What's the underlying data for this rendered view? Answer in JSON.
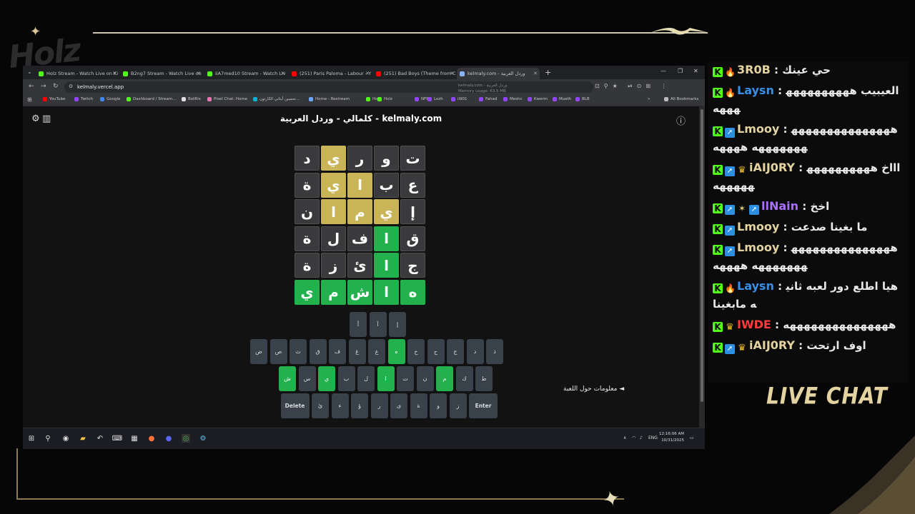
{
  "overlay": {
    "logo_text": "Holz",
    "live_chat_label": "LIVE CHAT"
  },
  "browser": {
    "tabs": [
      {
        "label": "Holz Stream - Watch Live on Ki",
        "color": "#53fc18"
      },
      {
        "label": "B2ng7 Stream - Watch Live on",
        "color": "#53fc18"
      },
      {
        "label": "iiA7med10 Stream - Watch Liv",
        "color": "#53fc18"
      },
      {
        "label": "(251) Paris Paloma - Labour - Y",
        "color": "#ff0000"
      },
      {
        "label": "(251) Bad Boys (Theme from Co",
        "color": "#ff0000"
      },
      {
        "label": "kelmaly.com - وردل العربية",
        "color": "#8ab4f8"
      }
    ],
    "url": "kelmaly.vercel.app",
    "suggestion_lines": [
      "kelmaly.com - وردل العربية",
      "Memory usage: 63.5 MB"
    ],
    "bookmarks": [
      {
        "label": "YouTube",
        "color": "#ff0000"
      },
      {
        "label": "Twitch",
        "color": "#9146ff"
      },
      {
        "label": "Google",
        "color": "#4285f4"
      },
      {
        "label": "Dashboard / Stream...",
        "color": "#53fc18"
      },
      {
        "label": "BotRix",
        "color": "#e0e0e0"
      },
      {
        "label": "Pixel Chat: Home",
        "color": "#f472b6"
      },
      {
        "label": "تحسين أبتاني الكارتون...",
        "color": "#00b4d8"
      },
      {
        "label": "Home - Restream",
        "color": "#6ea8fe"
      },
      {
        "label": "Holz",
        "color": "#53fc18"
      },
      {
        "label": "Holz",
        "color": "#53fc18"
      },
      {
        "label": "NFR",
        "color": "#9146ff"
      },
      {
        "label": "Lozh",
        "color": "#9146ff"
      },
      {
        "label": "ii901",
        "color": "#9146ff"
      },
      {
        "label": "Fahad",
        "color": "#9146ff"
      },
      {
        "label": "Meshc",
        "color": "#9146ff"
      },
      {
        "label": "Kwerm",
        "color": "#9146ff"
      },
      {
        "label": "Mueth",
        "color": "#9146ff"
      },
      {
        "label": "BLB",
        "color": "#9146ff"
      }
    ],
    "all_bookmarks": "All Bookmarks"
  },
  "page": {
    "title": "كلمالي - وردل العربية - kelmaly.com",
    "game_info": "معلومات حول اللعبة ◄"
  },
  "board": [
    [
      {
        "l": "ت",
        "s": "absent"
      },
      {
        "l": "و",
        "s": "absent"
      },
      {
        "l": "ر",
        "s": "absent"
      },
      {
        "l": "ي",
        "s": "present"
      },
      {
        "l": "د",
        "s": "absent"
      }
    ],
    [
      {
        "l": "ع",
        "s": "absent"
      },
      {
        "l": "ب",
        "s": "absent"
      },
      {
        "l": "ا",
        "s": "present"
      },
      {
        "l": "ي",
        "s": "present"
      },
      {
        "l": "ة",
        "s": "absent"
      }
    ],
    [
      {
        "l": "إ",
        "s": "absent"
      },
      {
        "l": "ي",
        "s": "present"
      },
      {
        "l": "م",
        "s": "present"
      },
      {
        "l": "ا",
        "s": "present"
      },
      {
        "l": "ن",
        "s": "absent"
      }
    ],
    [
      {
        "l": "ق",
        "s": "absent"
      },
      {
        "l": "ا",
        "s": "correct"
      },
      {
        "l": "ف",
        "s": "absent"
      },
      {
        "l": "ل",
        "s": "absent"
      },
      {
        "l": "ة",
        "s": "absent"
      }
    ],
    [
      {
        "l": "ج",
        "s": "absent"
      },
      {
        "l": "ا",
        "s": "correct"
      },
      {
        "l": "ئ",
        "s": "absent"
      },
      {
        "l": "ز",
        "s": "absent"
      },
      {
        "l": "ة",
        "s": "absent"
      }
    ],
    [
      {
        "l": "ه",
        "s": "correct"
      },
      {
        "l": "ا",
        "s": "correct"
      },
      {
        "l": "ش",
        "s": "correct"
      },
      {
        "l": "م",
        "s": "correct"
      },
      {
        "l": "ي",
        "s": "correct"
      }
    ]
  ],
  "keyboard": {
    "row1": [
      {
        "l": "إ",
        "s": "n"
      },
      {
        "l": "آ",
        "s": "n"
      },
      {
        "l": "أ",
        "s": "n"
      }
    ],
    "row2": [
      {
        "l": "ذ",
        "s": "n"
      },
      {
        "l": "د",
        "s": "n"
      },
      {
        "l": "ج",
        "s": "n"
      },
      {
        "l": "ح",
        "s": "n"
      },
      {
        "l": "خ",
        "s": "n"
      },
      {
        "l": "ه",
        "s": "c"
      },
      {
        "l": "ع",
        "s": "n"
      },
      {
        "l": "غ",
        "s": "n"
      },
      {
        "l": "ف",
        "s": "n"
      },
      {
        "l": "ق",
        "s": "n"
      },
      {
        "l": "ث",
        "s": "n"
      },
      {
        "l": "ص",
        "s": "n"
      },
      {
        "l": "ض",
        "s": "n"
      }
    ],
    "row3": [
      {
        "l": "ط",
        "s": "n"
      },
      {
        "l": "ك",
        "s": "n"
      },
      {
        "l": "م",
        "s": "c"
      },
      {
        "l": "ن",
        "s": "n"
      },
      {
        "l": "ت",
        "s": "n"
      },
      {
        "l": "ا",
        "s": "c"
      },
      {
        "l": "ل",
        "s": "n"
      },
      {
        "l": "ب",
        "s": "n"
      },
      {
        "l": "ي",
        "s": "c"
      },
      {
        "l": "س",
        "s": "n"
      },
      {
        "l": "ش",
        "s": "c"
      }
    ],
    "row4": [
      {
        "l": "Enter",
        "s": "w"
      },
      {
        "l": "ز",
        "s": "n"
      },
      {
        "l": "و",
        "s": "n"
      },
      {
        "l": "ة",
        "s": "n"
      },
      {
        "l": "ى",
        "s": "n"
      },
      {
        "l": "ر",
        "s": "n"
      },
      {
        "l": "ؤ",
        "s": "n"
      },
      {
        "l": "ء",
        "s": "n"
      },
      {
        "l": "ئ",
        "s": "n"
      },
      {
        "l": "Delete",
        "s": "w"
      }
    ]
  },
  "taskbar": {
    "lang": "ENG",
    "time": "12:16:06 AM",
    "date": "10/31/2025"
  },
  "chat": [
    {
      "badges": [
        "k",
        "fire"
      ],
      "user": "3R0B",
      "user_color": "#e3d3a1",
      "sep": " : ",
      "text": "حي عينك"
    },
    {
      "badges": [
        "k",
        "fire"
      ],
      "user": "Laysn",
      "user_color": "#3a8ee6",
      "sep": " : ",
      "text": "العيبيب هههههههههههههه"
    },
    {
      "badges": [
        "k",
        "blue"
      ],
      "user": "Lmooy",
      "user_color": "#e3d3a1",
      "sep": " : ",
      "text": "ههههههههههههههههههههههه ههههه"
    },
    {
      "badges": [
        "k",
        "blue",
        "crown"
      ],
      "user": "iAIJ0RY",
      "user_color": "#e3d3a1",
      "sep": " : ",
      "text": "اااخ هههههههههههههههه"
    },
    {
      "badges": [
        "k",
        "blue",
        "sparkle",
        "blue"
      ],
      "user": "llNain",
      "user_color": "#a970ff",
      "sep": " : ",
      "text": "اخخ"
    },
    {
      "badges": [
        "k",
        "blue"
      ],
      "user": "Lmooy",
      "user_color": "#e3d3a1",
      "sep": " : ",
      "text": "ما بغينا صدعت"
    },
    {
      "badges": [
        "k",
        "blue"
      ],
      "user": "Lmooy",
      "user_color": "#e3d3a1",
      "sep": " : ",
      "text": "ههههههههههههههههههههههه ههههه"
    },
    {
      "badges": [
        "k",
        "fire"
      ],
      "user": "Laysn",
      "user_color": "#3a8ee6",
      "sep": " : ",
      "text": "هيا اطلع دور لعبه ثانيه مابغينا"
    },
    {
      "badges": [
        "k",
        "crown"
      ],
      "user": "IWDE",
      "user_color": "#ff3b3b",
      "sep": " : ",
      "text": "هههههههههههههههه"
    },
    {
      "badges": [
        "k",
        "blue",
        "crown"
      ],
      "user": "iAIJ0RY",
      "user_color": "#e3d3a1",
      "sep": " : ",
      "text": "اوف ارتحت"
    }
  ]
}
